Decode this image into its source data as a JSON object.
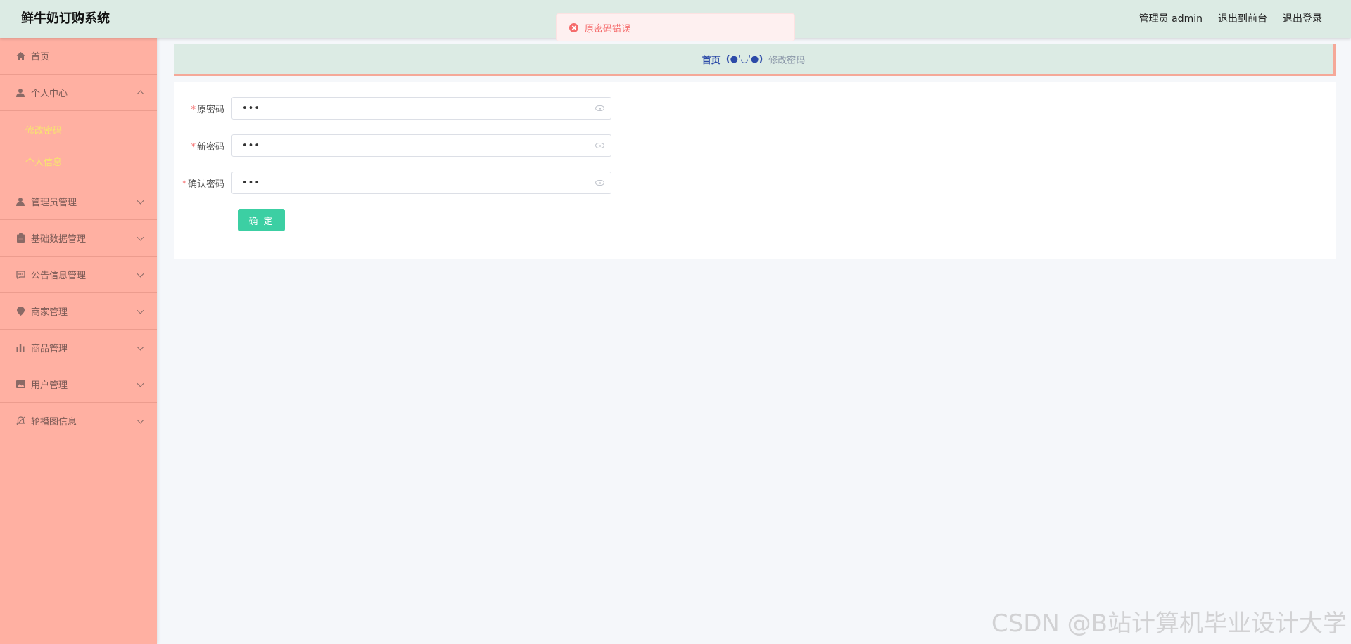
{
  "header": {
    "app_title": "鲜牛奶订购系统",
    "actions": [
      "管理员 admin",
      "退出到前台",
      "退出登录"
    ]
  },
  "toast": {
    "type": "error",
    "message": "原密码错误",
    "icon": "error-circle-icon"
  },
  "sidebar": {
    "items": [
      {
        "label": "首页",
        "icon": "home-icon"
      },
      {
        "label": "个人中心",
        "icon": "user-icon",
        "expanded": true,
        "children": [
          "修改密码",
          "个人信息"
        ]
      },
      {
        "label": "管理员管理",
        "icon": "user-icon"
      },
      {
        "label": "基础数据管理",
        "icon": "clipboard-icon"
      },
      {
        "label": "公告信息管理",
        "icon": "chat-icon"
      },
      {
        "label": "商家管理",
        "icon": "location-icon"
      },
      {
        "label": "商品管理",
        "icon": "bar-chart-icon"
      },
      {
        "label": "用户管理",
        "icon": "picture-icon"
      },
      {
        "label": "轮播图信息",
        "icon": "bell-off-icon"
      }
    ]
  },
  "breadcrumb": {
    "home": "首页",
    "separator": "(●'◡'●)",
    "current": "修改密码"
  },
  "form": {
    "fields": [
      {
        "label": "原密码",
        "value": "•••",
        "required": true
      },
      {
        "label": "新密码",
        "value": "•••",
        "required": true
      },
      {
        "label": "确认密码",
        "value": "•••",
        "required": true
      }
    ],
    "submit_label": "确 定"
  },
  "watermark": "CSDN @B站计算机毕业设计大学",
  "colors": {
    "header_bg": "#dcebe4",
    "sidebar_bg": "#ffb0a2",
    "submenu_text": "#f7e66d",
    "error": "#f56c6c",
    "primary_button": "#3ccfa3"
  }
}
